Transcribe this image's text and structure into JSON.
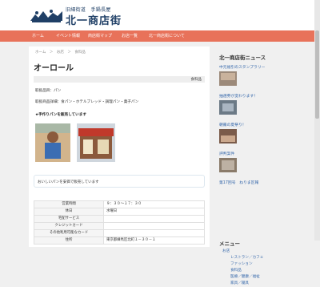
{
  "header": {
    "sub": "旧細街道　手鍋長屋",
    "name": "北一商店街"
  },
  "nav": {
    "items": [
      "ホーム",
      "イベント情報",
      "商店街マップ",
      "お店一覧",
      "北一商店街について"
    ]
  },
  "breadcrumb": "ホーム　＞　お店　＞　食料品",
  "title": "オーロール",
  "category_tag": "食料品",
  "info": {
    "line1": "取扱品目：パン",
    "line2": "取扱商品詳細：食パン・ホテルブレッド・調理パン・菓子パン"
  },
  "recommend": "★手作りパンを販売しています",
  "caption": "おいしいパンを安価で販売しています",
  "table": [
    {
      "k": "営業時間",
      "v": "９：３０～１７：３０"
    },
    {
      "k": "休日",
      "v": "水曜日"
    },
    {
      "k": "宅配サービス",
      "v": ""
    },
    {
      "k": "クレジットカード",
      "v": ""
    },
    {
      "k": "その他利用可能なカード",
      "v": ""
    },
    {
      "k": "住所",
      "v": "東京都練馬区北町１－３０－１"
    }
  ],
  "sidebar": {
    "title": "北一商店街ニュース",
    "news": [
      {
        "title": "中元福引のスタンプラリー"
      },
      {
        "title": "抽選券が変わります！"
      },
      {
        "title": "朝霧の夏祭り！"
      },
      {
        "title": "評判案件"
      },
      {
        "title": "第17回号　ねりま区報"
      }
    ],
    "menu_title": "メニュー",
    "menu_items": [
      "お店",
      "レストラン／カフェ",
      "ファッション",
      "食料品",
      "医療／健康／福祉",
      "家具／寝具"
    ]
  }
}
